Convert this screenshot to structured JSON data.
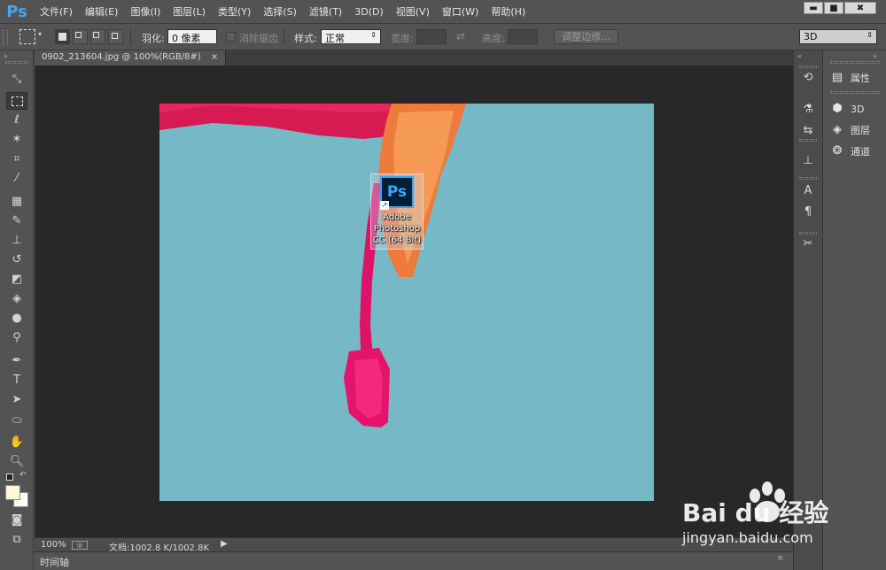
{
  "menubar": {
    "logo": "Ps",
    "items": [
      "文件(F)",
      "编辑(E)",
      "图像(I)",
      "图层(L)",
      "类型(Y)",
      "选择(S)",
      "滤镜(T)",
      "3D(D)",
      "视图(V)",
      "窗口(W)",
      "帮助(H)"
    ],
    "window_buttons": [
      "▬",
      "■",
      "✖"
    ]
  },
  "options": {
    "feather_label": "羽化:",
    "feather_value": "0 像素",
    "antialias_label": "消除锯齿",
    "style_label": "样式:",
    "style_value": "正常",
    "width_label": "宽度:",
    "height_label": "高度:",
    "refine_edge": "调整边缘...",
    "workspace": "3D"
  },
  "document": {
    "tab_title": "0902_213604.jpg @ 100%(RGB/8#)",
    "tab_close": "×"
  },
  "desktop_icon": {
    "tile_text": "Ps",
    "label_line1": "Adobe",
    "label_line2": "Photoshop",
    "label_line3": "CC (64 Bit)"
  },
  "status": {
    "zoom": "100%",
    "doc_info": "文档:1002.8 K/1002.8K"
  },
  "timeline": {
    "label": "时间轴"
  },
  "panels": {
    "items": [
      "属性",
      "3D",
      "图层",
      "通道"
    ]
  },
  "watermark": {
    "brand": "Bai du 经验",
    "url": "jingyan.baidu.com"
  },
  "colors": {
    "foreground": "#fcf8d8",
    "background": "#ffffff",
    "image_bg": "#76b9c6"
  }
}
